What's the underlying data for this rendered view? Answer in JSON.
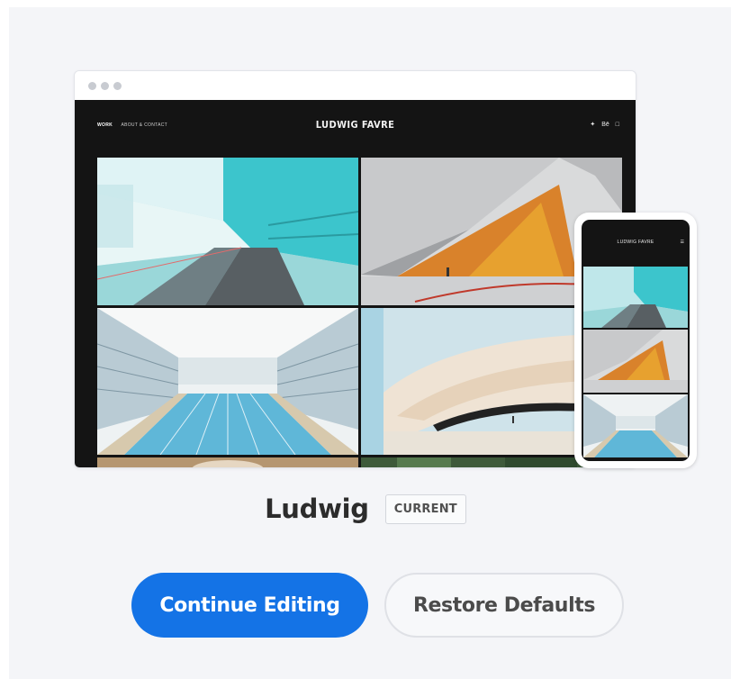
{
  "theme": {
    "name": "Ludwig",
    "badge": "CURRENT"
  },
  "preview": {
    "site_title": "LUDWIG FAVRE",
    "nav": [
      "WORK",
      "ABOUT & CONTACT"
    ],
    "social_icons": [
      "twitter-icon",
      "behance-icon",
      "instagram-icon"
    ],
    "phone_title": "LUDWIG FAVRE"
  },
  "buttons": {
    "primary": "Continue Editing",
    "secondary": "Restore Defaults"
  },
  "colors": {
    "accent": "#1473e6",
    "panel_bg": "#f4f5f8",
    "site_bg": "#141414"
  }
}
